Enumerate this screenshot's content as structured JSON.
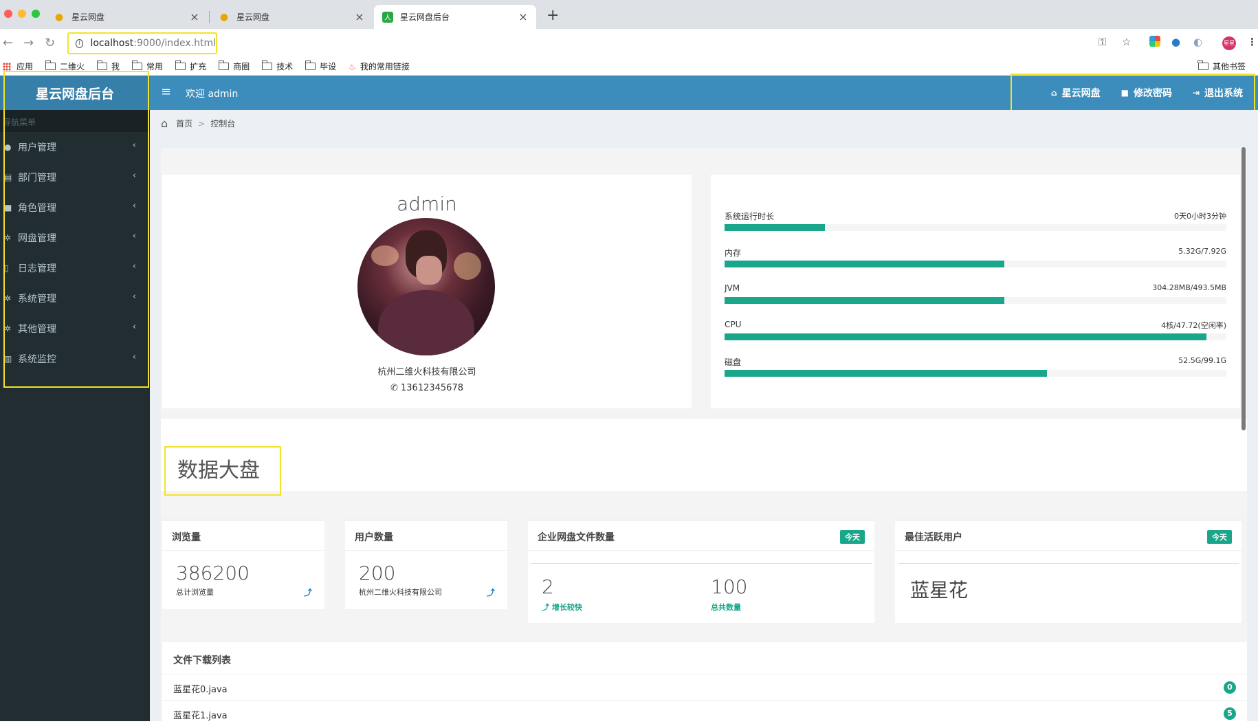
{
  "browser": {
    "tabs": [
      {
        "label": "星云网盘"
      },
      {
        "label": "星云网盘"
      },
      {
        "label": "星云网盘后台"
      }
    ],
    "url_host": "localhost",
    "url_rest": ":9000/index.html",
    "bookmarks": [
      "应用",
      "二维火",
      "我",
      "常用",
      "扩充",
      "商圈",
      "技术",
      "毕设",
      "我的常用链接"
    ],
    "other_bookmarks": "其他书签",
    "profile_label": "星星"
  },
  "sidebar": {
    "brand": "星云网盘后台",
    "header": "导航菜单",
    "items": [
      {
        "label": "用户管理",
        "icon": "user-icon"
      },
      {
        "label": "部门管理",
        "icon": "id-card-icon"
      },
      {
        "label": "角色管理",
        "icon": "lock-icon"
      },
      {
        "label": "网盘管理",
        "icon": "gear-icon"
      },
      {
        "label": "日志管理",
        "icon": "document-icon"
      },
      {
        "label": "系统管理",
        "icon": "gear-icon"
      },
      {
        "label": "其他管理",
        "icon": "gear-icon"
      },
      {
        "label": "系统监控",
        "icon": "bar-chart-icon"
      }
    ]
  },
  "topnav": {
    "welcome": "欢迎 admin",
    "links": [
      {
        "label": "星云网盘",
        "icon": "home-icon"
      },
      {
        "label": "修改密码",
        "icon": "lock-icon"
      },
      {
        "label": "退出系统",
        "icon": "sign-out-icon"
      }
    ]
  },
  "breadcrumb": {
    "home": "首页",
    "current": "控制台"
  },
  "profile": {
    "name": "admin",
    "company": "杭州二维火科技有限公司",
    "phone": "13612345678"
  },
  "system_stats": [
    {
      "label": "系统运行时长",
      "value": "0天0小时3分钟",
      "percent": 20
    },
    {
      "label": "内存",
      "value": "5.32G/7.92G",
      "percent": 55.7
    },
    {
      "label": "JVM",
      "value": "304.28MB/493.5MB",
      "percent": 55.7
    },
    {
      "label": "CPU",
      "value": "4核/47.72(空闲率)",
      "percent": 96
    },
    {
      "label": "磁盘",
      "value": "52.5G/99.1G",
      "percent": 64.3
    }
  ],
  "dashboard": {
    "section_title": "数据大盘",
    "views": {
      "title": "浏览量",
      "value": "386200",
      "label": "总计浏览量"
    },
    "users": {
      "title": "用户数量",
      "value": "200",
      "label": "杭州二维火科技有限公司"
    },
    "files": {
      "title": "企业网盘文件数量",
      "badge": "今天",
      "value1": "2",
      "label1": "增长较快",
      "value2": "100",
      "label2": "总共数量"
    },
    "active_user": {
      "title": "最佳活跃用户",
      "badge": "今天",
      "name": "蓝星花"
    }
  },
  "downloads": {
    "title": "文件下载列表",
    "items": [
      {
        "name": "蓝星花0.java",
        "count": "0"
      },
      {
        "name": "蓝星花1.java",
        "count": "5"
      }
    ]
  },
  "colors": {
    "header_blue": "#3c8dbc",
    "brand_blue": "#367fa9",
    "sidebar_dark": "#222d32",
    "accent_green": "#1aa68a",
    "highlight_yellow": "#f3e22a"
  }
}
